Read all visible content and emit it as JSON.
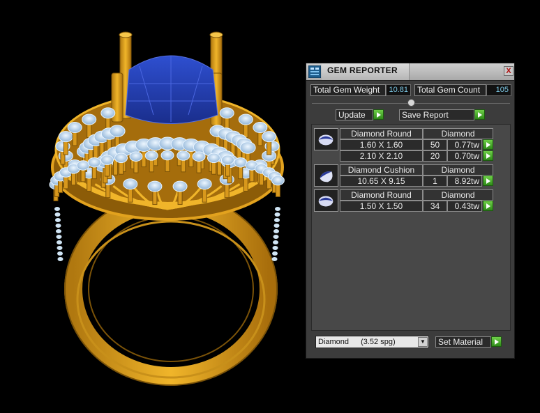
{
  "panel": {
    "title": "GEM REPORTER",
    "close": "X",
    "total_weight_label": "Total Gem Weight",
    "total_weight_value": "10.81",
    "total_count_label": "Total Gem Count",
    "total_count_value": "105",
    "update_label": "Update",
    "save_report_label": "Save Report",
    "gems": [
      {
        "type": "Diamond Round",
        "material": "Diamond",
        "rows": [
          {
            "size": "1.60 X 1.60",
            "count": "50",
            "weight": "0.77tw"
          },
          {
            "size": "2.10 X 2.10",
            "count": "20",
            "weight": "0.70tw"
          }
        ]
      },
      {
        "type": "Diamond Cushion",
        "material": "Diamond",
        "rows": [
          {
            "size": "10.65 X 9.15",
            "count": "1",
            "weight": "8.92tw"
          }
        ]
      },
      {
        "type": "Diamond Round",
        "material": "Diamond",
        "rows": [
          {
            "size": "1.50 X 1.50",
            "count": "34",
            "weight": "0.43tw"
          }
        ]
      }
    ],
    "material_select": {
      "value": "Diamond",
      "spg": "(3.52 spg)"
    },
    "set_material_label": "Set Material"
  },
  "colors": {
    "gold": "#e2a21e",
    "sapphire": "#1f3fb0",
    "diamond": "#bcd8ee",
    "panel": "#3c3c3c",
    "accent_green": "#3fae25"
  },
  "icons": {
    "app": "gem-reporter-icon",
    "close": "close-icon",
    "play": "play-arrow-icon",
    "dropdown": "chevron-down-icon"
  }
}
